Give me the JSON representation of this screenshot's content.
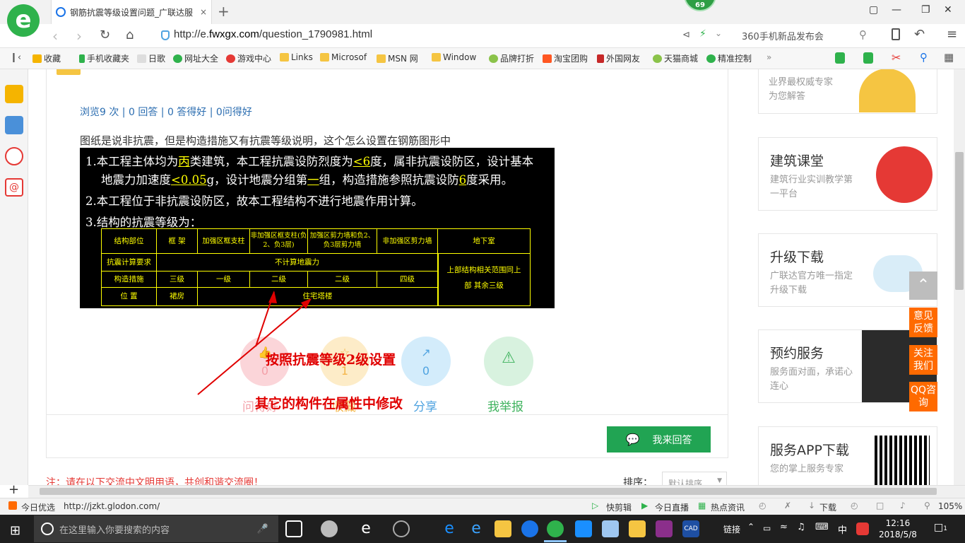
{
  "browser": {
    "tab_title": "钢筋抗震等级设置问题_广联达服",
    "tab_close": "×",
    "new_tab": "+",
    "badge_count": "69",
    "url_prefix": "http://e.",
    "url_domain": "fwxgx.com",
    "url_path": "/question_1790981.html",
    "news_item": "360手机新品发布会"
  },
  "bookmarks": [
    {
      "label": "收藏",
      "color": "#f5b400"
    },
    {
      "label": "手机收藏夹",
      "color": "#2fb24c"
    },
    {
      "label": "日歌",
      "color": "#bbbbbb"
    },
    {
      "label": "网址大全",
      "color": "#2fb24c"
    },
    {
      "label": "游戏中心",
      "color": "#e53935"
    },
    {
      "label": "Links",
      "color": "#f5c542"
    },
    {
      "label": "Microsof",
      "color": "#f5c542"
    },
    {
      "label": "MSN 网",
      "color": "#f5c542"
    },
    {
      "label": "Window",
      "color": "#f5c542"
    },
    {
      "label": "品牌打折",
      "color": "#8bc34a"
    },
    {
      "label": "淘宝团购",
      "color": "#ff5722"
    },
    {
      "label": "外国网友",
      "color": "#c62828"
    },
    {
      "label": "天猫商城",
      "color": "#8bc34a"
    },
    {
      "label": "精准控制",
      "color": "#2fb24c"
    }
  ],
  "question": {
    "stats": "浏览9 次 | 0 回答 | 0 答得好 | 0问得好",
    "body": "图纸是说非抗震，但是构造措施又有抗震等级说明，这个怎么设置在钢筋图形中"
  },
  "drawing": {
    "line1_a": "1.本工程主体均为",
    "line1_b": "丙",
    "line1_c": "类建筑，本工程抗震设防烈度为",
    "line1_d": "<6",
    "line1_e": "度，属非抗震设防区，设计基本",
    "line2_a": "地震力加速度",
    "line2_b": "<0.05",
    "line2_c": "g，设计地震分组第",
    "line2_d": "一",
    "line2_e": "组，构造措施参照抗震设防",
    "line2_f": "6",
    "line2_g": "度采用。",
    "line3": "2.本工程位于非抗震设防区，故本工程结构不进行地震作用计算。",
    "line4": "3.结构的抗震等级为：",
    "table_header": [
      "结构部位",
      "框  架",
      "加强区框支柱",
      "非加强区框支柱(负2、负3层)",
      "加强区剪力墙和负2、负3层剪力墙",
      "非加强区剪力墙",
      "地下室"
    ],
    "row_calc_label": "抗震计算要求",
    "row_calc_value": "不计算地震力",
    "row_basement": "上部结构相关范围同上部 其余三级",
    "row_measure": [
      "构造措施",
      "三级",
      "一级",
      "二级",
      "二级",
      "四级"
    ],
    "row_position": [
      "位    置",
      "裙房",
      "住宅塔楼"
    ]
  },
  "annotations": {
    "a1": "按照抗震等级2级设置",
    "a2": "其它的构件在属性中修改"
  },
  "actions": [
    {
      "label": "问得好",
      "count": "0",
      "bg": "#fbd5d9",
      "fg": "#f3a0a8"
    },
    {
      "label": "收藏",
      "count": "1",
      "bg": "#fdecc8",
      "fg": "#f5b64a"
    },
    {
      "label": "分享",
      "count": "0",
      "bg": "#d3ecfb",
      "fg": "#4fa3e0"
    },
    {
      "label": "我举报",
      "count": "",
      "bg": "#d8f2df",
      "fg": "#3fb35e"
    }
  ],
  "answer_button": "我来回答",
  "notice": "注：请在以下交流中文明用语，共创和谐交流圈！",
  "sort": {
    "label": "排序：",
    "value": "默认排序"
  },
  "right": {
    "top_card": [
      "业界最权威专家",
      "为您解答"
    ],
    "cards": [
      {
        "title": "建筑课堂",
        "desc": "建筑行业实训教学第一平台"
      },
      {
        "title": "升级下载",
        "desc": "广联达官方唯一指定升级下载"
      },
      {
        "title": "预约服务",
        "desc": "服务面对面，承诺心连心"
      },
      {
        "title": "服务APP下载",
        "desc": "您的掌上服务专家"
      }
    ],
    "float_buttons": [
      "意见反馈",
      "关注我们",
      "QQ咨询"
    ]
  },
  "status": {
    "today": "今日优选",
    "link": "http://jzkt.glodon.com/",
    "items": [
      "快剪辑",
      "今日直播",
      "热点资讯",
      "下载"
    ],
    "zoom": "105%"
  },
  "taskbar": {
    "search_placeholder": "在这里输入你要搜索的内容",
    "link_label": "链接",
    "ime": "中",
    "time": "12:16",
    "date": "2018/5/8",
    "notif": "1"
  }
}
